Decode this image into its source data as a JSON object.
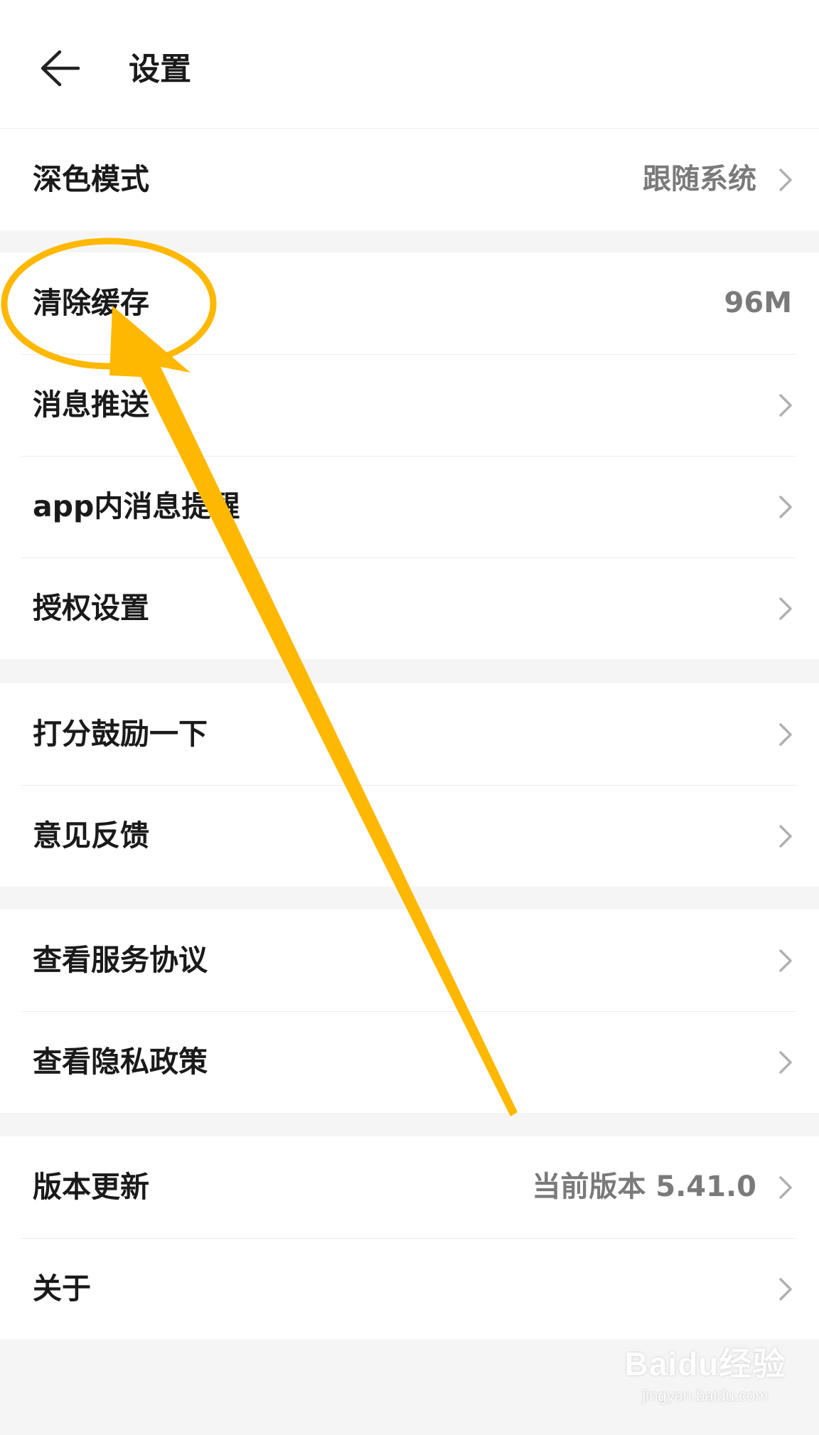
{
  "header": {
    "back_icon": "arrow-left-icon",
    "title": "设置"
  },
  "groups": [
    {
      "rows": [
        {
          "label": "深色模式",
          "value": "跟随系统",
          "chevron": true
        }
      ]
    },
    {
      "rows": [
        {
          "label": "清除缓存",
          "value": "96M",
          "chevron": false
        },
        {
          "label": "消息推送",
          "value": "",
          "chevron": true
        },
        {
          "label": "app内消息提醒",
          "value": "",
          "chevron": true
        },
        {
          "label": "授权设置",
          "value": "",
          "chevron": true
        }
      ]
    },
    {
      "rows": [
        {
          "label": "打分鼓励一下",
          "value": "",
          "chevron": true
        },
        {
          "label": "意见反馈",
          "value": "",
          "chevron": true
        }
      ]
    },
    {
      "rows": [
        {
          "label": "查看服务协议",
          "value": "",
          "chevron": true
        },
        {
          "label": "查看隐私政策",
          "value": "",
          "chevron": true
        }
      ]
    },
    {
      "rows": [
        {
          "label": "版本更新",
          "value": "当前版本 5.41.0",
          "chevron": true
        },
        {
          "label": "关于",
          "value": "",
          "chevron": true
        }
      ]
    }
  ],
  "annotation": {
    "shapes": [
      "ellipse-highlight",
      "arrow-pointer"
    ],
    "color": "#FFB800"
  },
  "watermark": {
    "logo": "Baidu经验",
    "site": "jingyan.baidu.com"
  },
  "colors": {
    "background": "#f5f5f5",
    "card": "#ffffff",
    "primary_text": "#1a1a1a",
    "secondary_text": "#7a7a7a",
    "chevron": "#b0b0b0"
  }
}
